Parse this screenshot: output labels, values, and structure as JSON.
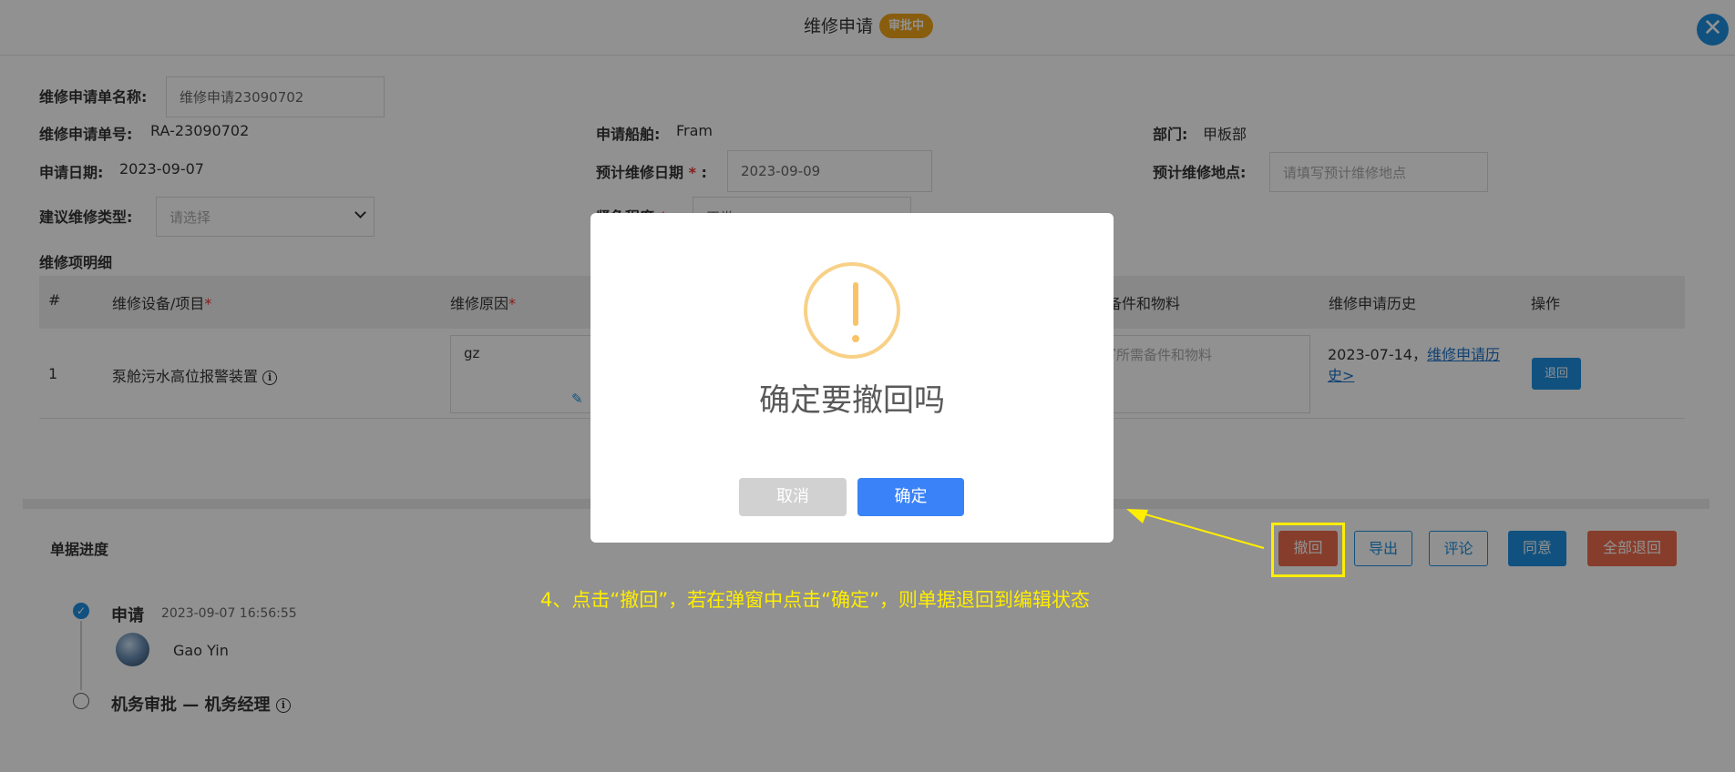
{
  "header": {
    "title": "维修申请",
    "status_badge": "审批中",
    "close_icon": "close-icon"
  },
  "form": {
    "name_label": "维修申请单名称:",
    "name_value": "维修申请23090702",
    "number_label": "维修申请单号:",
    "number_value": "RA-23090702",
    "ship_label": "申请船舶:",
    "ship_value": "Fram",
    "dept_label": "部门:",
    "dept_value": "甲板部",
    "date_label": "申请日期:",
    "date_value": "2023-09-07",
    "planned_date_label": "预计维修日期",
    "planned_date_value": "2023-09-09",
    "location_label": "预计维修地点:",
    "location_placeholder": "请填写预计维修地点",
    "type_label": "建议维修类型:",
    "type_placeholder": "请选择",
    "urgency_label": "紧急程度",
    "urgency_value": "正常"
  },
  "detail": {
    "section_title": "维修项明细",
    "columns": {
      "index": "#",
      "equipment": "维修设备/项目",
      "reason": "维修原因",
      "parts": "备件和物料",
      "history": "维修申请历史",
      "action": "操作"
    },
    "rows": [
      {
        "index": "1",
        "equipment": "泵舱污水高位报警装置",
        "reason": "gz",
        "parts_placeholder": "写所需备件和物料",
        "history_date": "2023-07-14，",
        "history_link": "维修申请历史>",
        "action_label": "退回"
      }
    ]
  },
  "progress": {
    "section_title": "单据进度",
    "steps": [
      {
        "title": "申请",
        "time": "2023-09-07 16:56:55",
        "user": "Gao Yin",
        "done": true
      },
      {
        "title": "机务审批 — 机务经理",
        "done": false
      }
    ]
  },
  "actions": {
    "withdraw": "撤回",
    "export": "导出",
    "comment": "评论",
    "approve": "同意",
    "return_all": "全部退回"
  },
  "modal": {
    "icon": "warning-icon",
    "message": "确定要撤回吗",
    "cancel": "取消",
    "confirm": "确定"
  },
  "annotation": {
    "text": "4、点击“撤回”，若在弹窗中点击“确定”，则单据退回到编辑状态"
  },
  "colors": {
    "primary": "#1d8fe0",
    "badge": "#f0a41a",
    "danger": "#ee6c4d",
    "annotation": "#ffee00",
    "warning": "#f8c467"
  }
}
